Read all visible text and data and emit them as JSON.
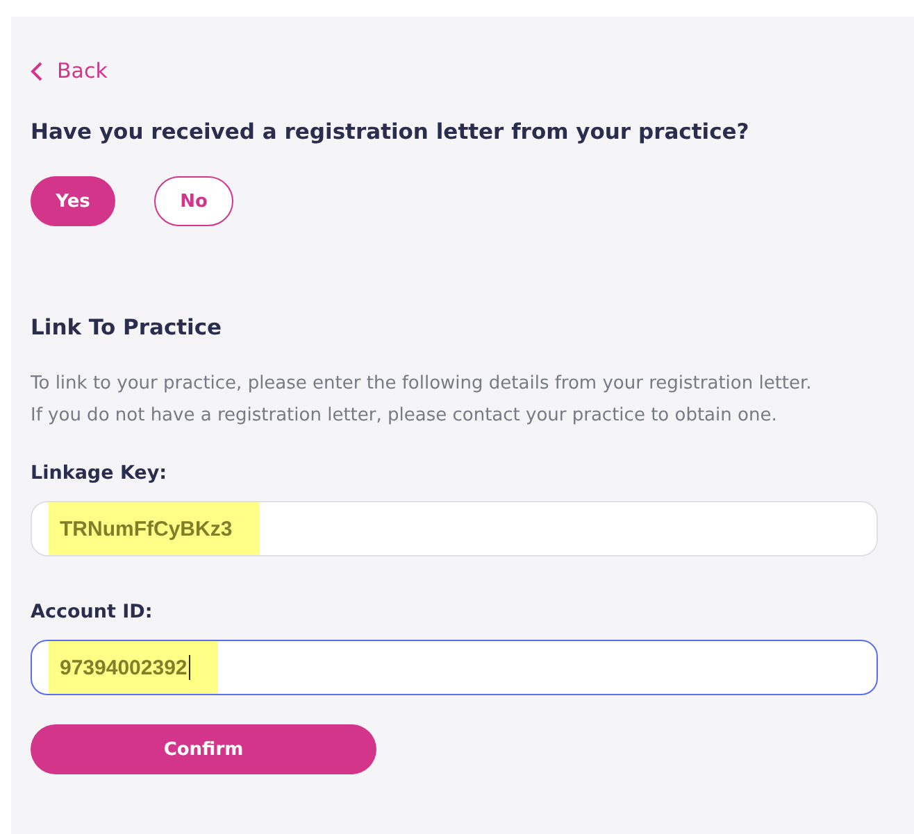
{
  "back_link": {
    "label": "Back"
  },
  "question": "Have you received a registration letter from your practice?",
  "answers": [
    {
      "label": "Yes",
      "selected": true
    },
    {
      "label": "No",
      "selected": false
    }
  ],
  "section": {
    "title": "Link To Practice",
    "description": [
      "To link to your practice, please enter the following details from your registration letter.",
      "If you do not have a registration letter, please contact your practice to obtain one."
    ]
  },
  "fields": [
    {
      "label": "Linkage Key:",
      "value": "TRNumFfCyBKz3",
      "focused": false,
      "highlighted": true
    },
    {
      "label": "Account ID:",
      "value": "97394002392",
      "focused": true,
      "highlighted": true
    }
  ],
  "confirm_button": {
    "label": "Confirm"
  }
}
